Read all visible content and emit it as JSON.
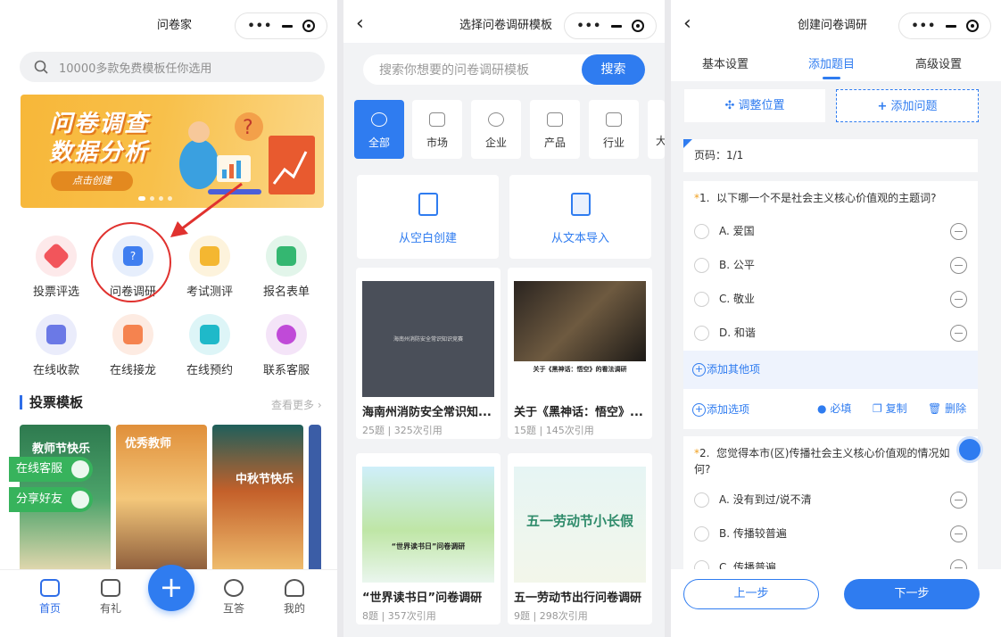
{
  "home": {
    "title": "问卷家",
    "search_placeholder": "10000多款免费模板任你选用",
    "banner": {
      "line1": "问卷调查",
      "line2": "数据分析",
      "button": "点击创建"
    },
    "shortcuts": [
      {
        "label": "投票评选",
        "color": "#f2555b",
        "bg": "#fde9ea",
        "icon": "vote-icon"
      },
      {
        "label": "问卷调研",
        "color": "#3f7ef0",
        "bg": "#e6eefc",
        "icon": "questionnaire-icon"
      },
      {
        "label": "考试测评",
        "color": "#f4b731",
        "bg": "#fdf3dc",
        "icon": "exam-icon"
      },
      {
        "label": "报名表单",
        "color": "#34b771",
        "bg": "#e2f5ea",
        "icon": "signup-form-icon"
      },
      {
        "label": "在线收款",
        "color": "#6b79e6",
        "bg": "#eaecfb",
        "icon": "payment-icon"
      },
      {
        "label": "在线接龙",
        "color": "#f5834f",
        "bg": "#fdebe2",
        "icon": "list-relay-icon"
      },
      {
        "label": "在线预约",
        "color": "#1fb9c9",
        "bg": "#ddf5f7",
        "icon": "calendar-icon"
      },
      {
        "label": "联系客服",
        "color": "#c04ad8",
        "bg": "#f4e4f8",
        "icon": "chat-icon"
      }
    ],
    "section_title": "投票模板",
    "section_more": "查看更多",
    "thumb_texts": [
      "教师节快乐",
      "优秀教师",
      "中秋节快乐"
    ],
    "float_service": "在线客服",
    "float_share": "分享好友",
    "tabs": [
      {
        "label": "首页",
        "icon": "home-icon"
      },
      {
        "label": "有礼",
        "icon": "gift-icon"
      },
      {
        "label": "互答",
        "icon": "exchange-icon"
      },
      {
        "label": "我的",
        "icon": "user-icon"
      }
    ],
    "fab": "+"
  },
  "templates": {
    "title": "选择问卷调研模板",
    "search_placeholder": "搜索你想要的问卷调研模板",
    "search_button": "搜索",
    "categories": [
      "全部",
      "市场",
      "企业",
      "产品",
      "行业",
      "大"
    ],
    "blank_create": "从空白创建",
    "text_import": "从文本导入",
    "cards": [
      {
        "title": "海南州消防安全常识知...",
        "meta": "25题 | 325次引用",
        "img_text": "海南州消防安全常识知识竞赛"
      },
      {
        "title": "关于《黑神话：悟空》...",
        "meta": "15题 | 145次引用",
        "img_caption": "关于《黑神话：悟空》的看法调研"
      },
      {
        "title": "“世界读书日”问卷调研",
        "meta": "8题 | 357次引用",
        "img_caption": "“世界读书日”问卷调研"
      },
      {
        "title": "五一劳动节出行问卷调研",
        "meta": "9题 | 298次引用",
        "img_caption": "五一劳动节小长假"
      }
    ]
  },
  "editor": {
    "title": "创建问卷调研",
    "tabs": [
      "基本设置",
      "添加题目",
      "高级设置"
    ],
    "adjust": "调整位置",
    "add_question": "添加问题",
    "page_label": "页码：1/1",
    "q1": {
      "number": "1.",
      "text": "以下哪一个不是社会主义核心价值观的主题词?",
      "options": [
        "A. 爱国",
        "B. 公平",
        "C. 敬业",
        "D. 和谐"
      ],
      "add_other": "添加其他项",
      "add_option": "添加选项",
      "required": "必填",
      "copy": "复制",
      "delete": "删除"
    },
    "q2": {
      "number": "2.",
      "text": "您觉得本市(区)传播社会主义核心价值观的情况如何?",
      "options": [
        "A. 没有到过/说不清",
        "B. 传播较普遍",
        "C. 传播普遍"
      ]
    },
    "prev": "上一步",
    "next": "下一步"
  }
}
